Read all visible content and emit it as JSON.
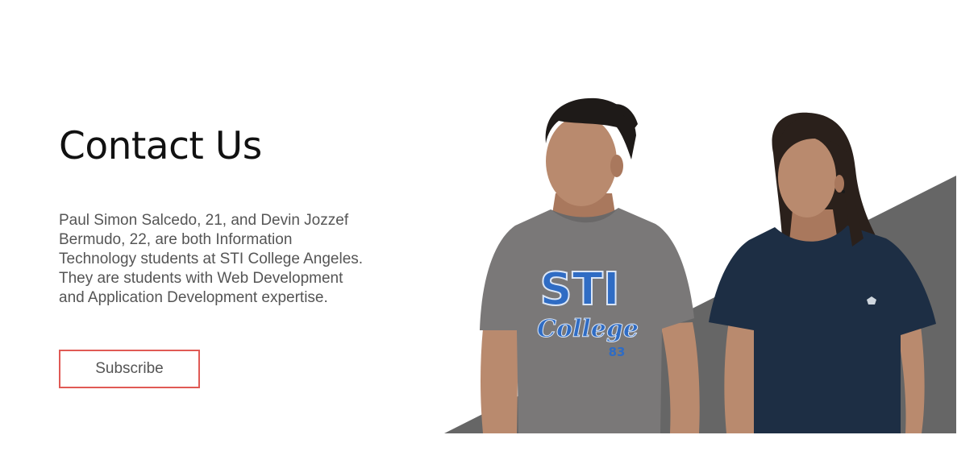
{
  "contact": {
    "title": "Contact Us",
    "description": "Paul Simon Salcedo, 21, and Devin Jozzef Bermudo, 22, are both Information Technology students at STI College Angeles. They are students with Web Development and Application Development expertise.",
    "subscribe_label": "Subscribe"
  },
  "hero": {
    "shirt_left": {
      "line1": "STI",
      "line2": "College",
      "number": "83"
    }
  },
  "colors": {
    "accent_border": "#e05a55",
    "diagonal_band": "#666666",
    "shirt_gray": "#7a7878",
    "shirt_navy": "#1d2e44",
    "print_blue": "#2f6cc4"
  }
}
